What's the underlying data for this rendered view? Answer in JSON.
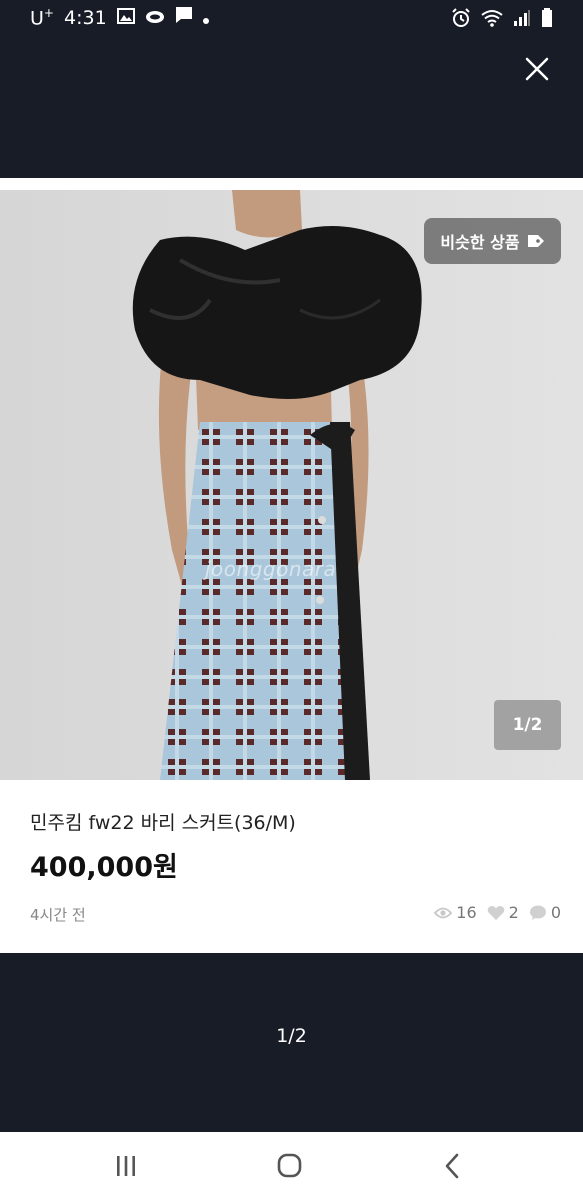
{
  "status_bar": {
    "carrier": "U",
    "carrier_sup": "+",
    "time": "4:31"
  },
  "product": {
    "similar_button_label": "비슷한 상품",
    "image_counter": "1/2",
    "watermark": "joonggonara",
    "title": "민주킴 fw22 바리 스커트(36/M)",
    "price": "400,000원",
    "time_ago": "4시간 전",
    "views": "16",
    "likes": "2",
    "chats": "0"
  },
  "pager": "1/2",
  "colors": {
    "background": "#171c26",
    "card": "#ffffff",
    "skirt_blue": "#a9c6da",
    "skirt_brown": "#5a2a2a"
  }
}
